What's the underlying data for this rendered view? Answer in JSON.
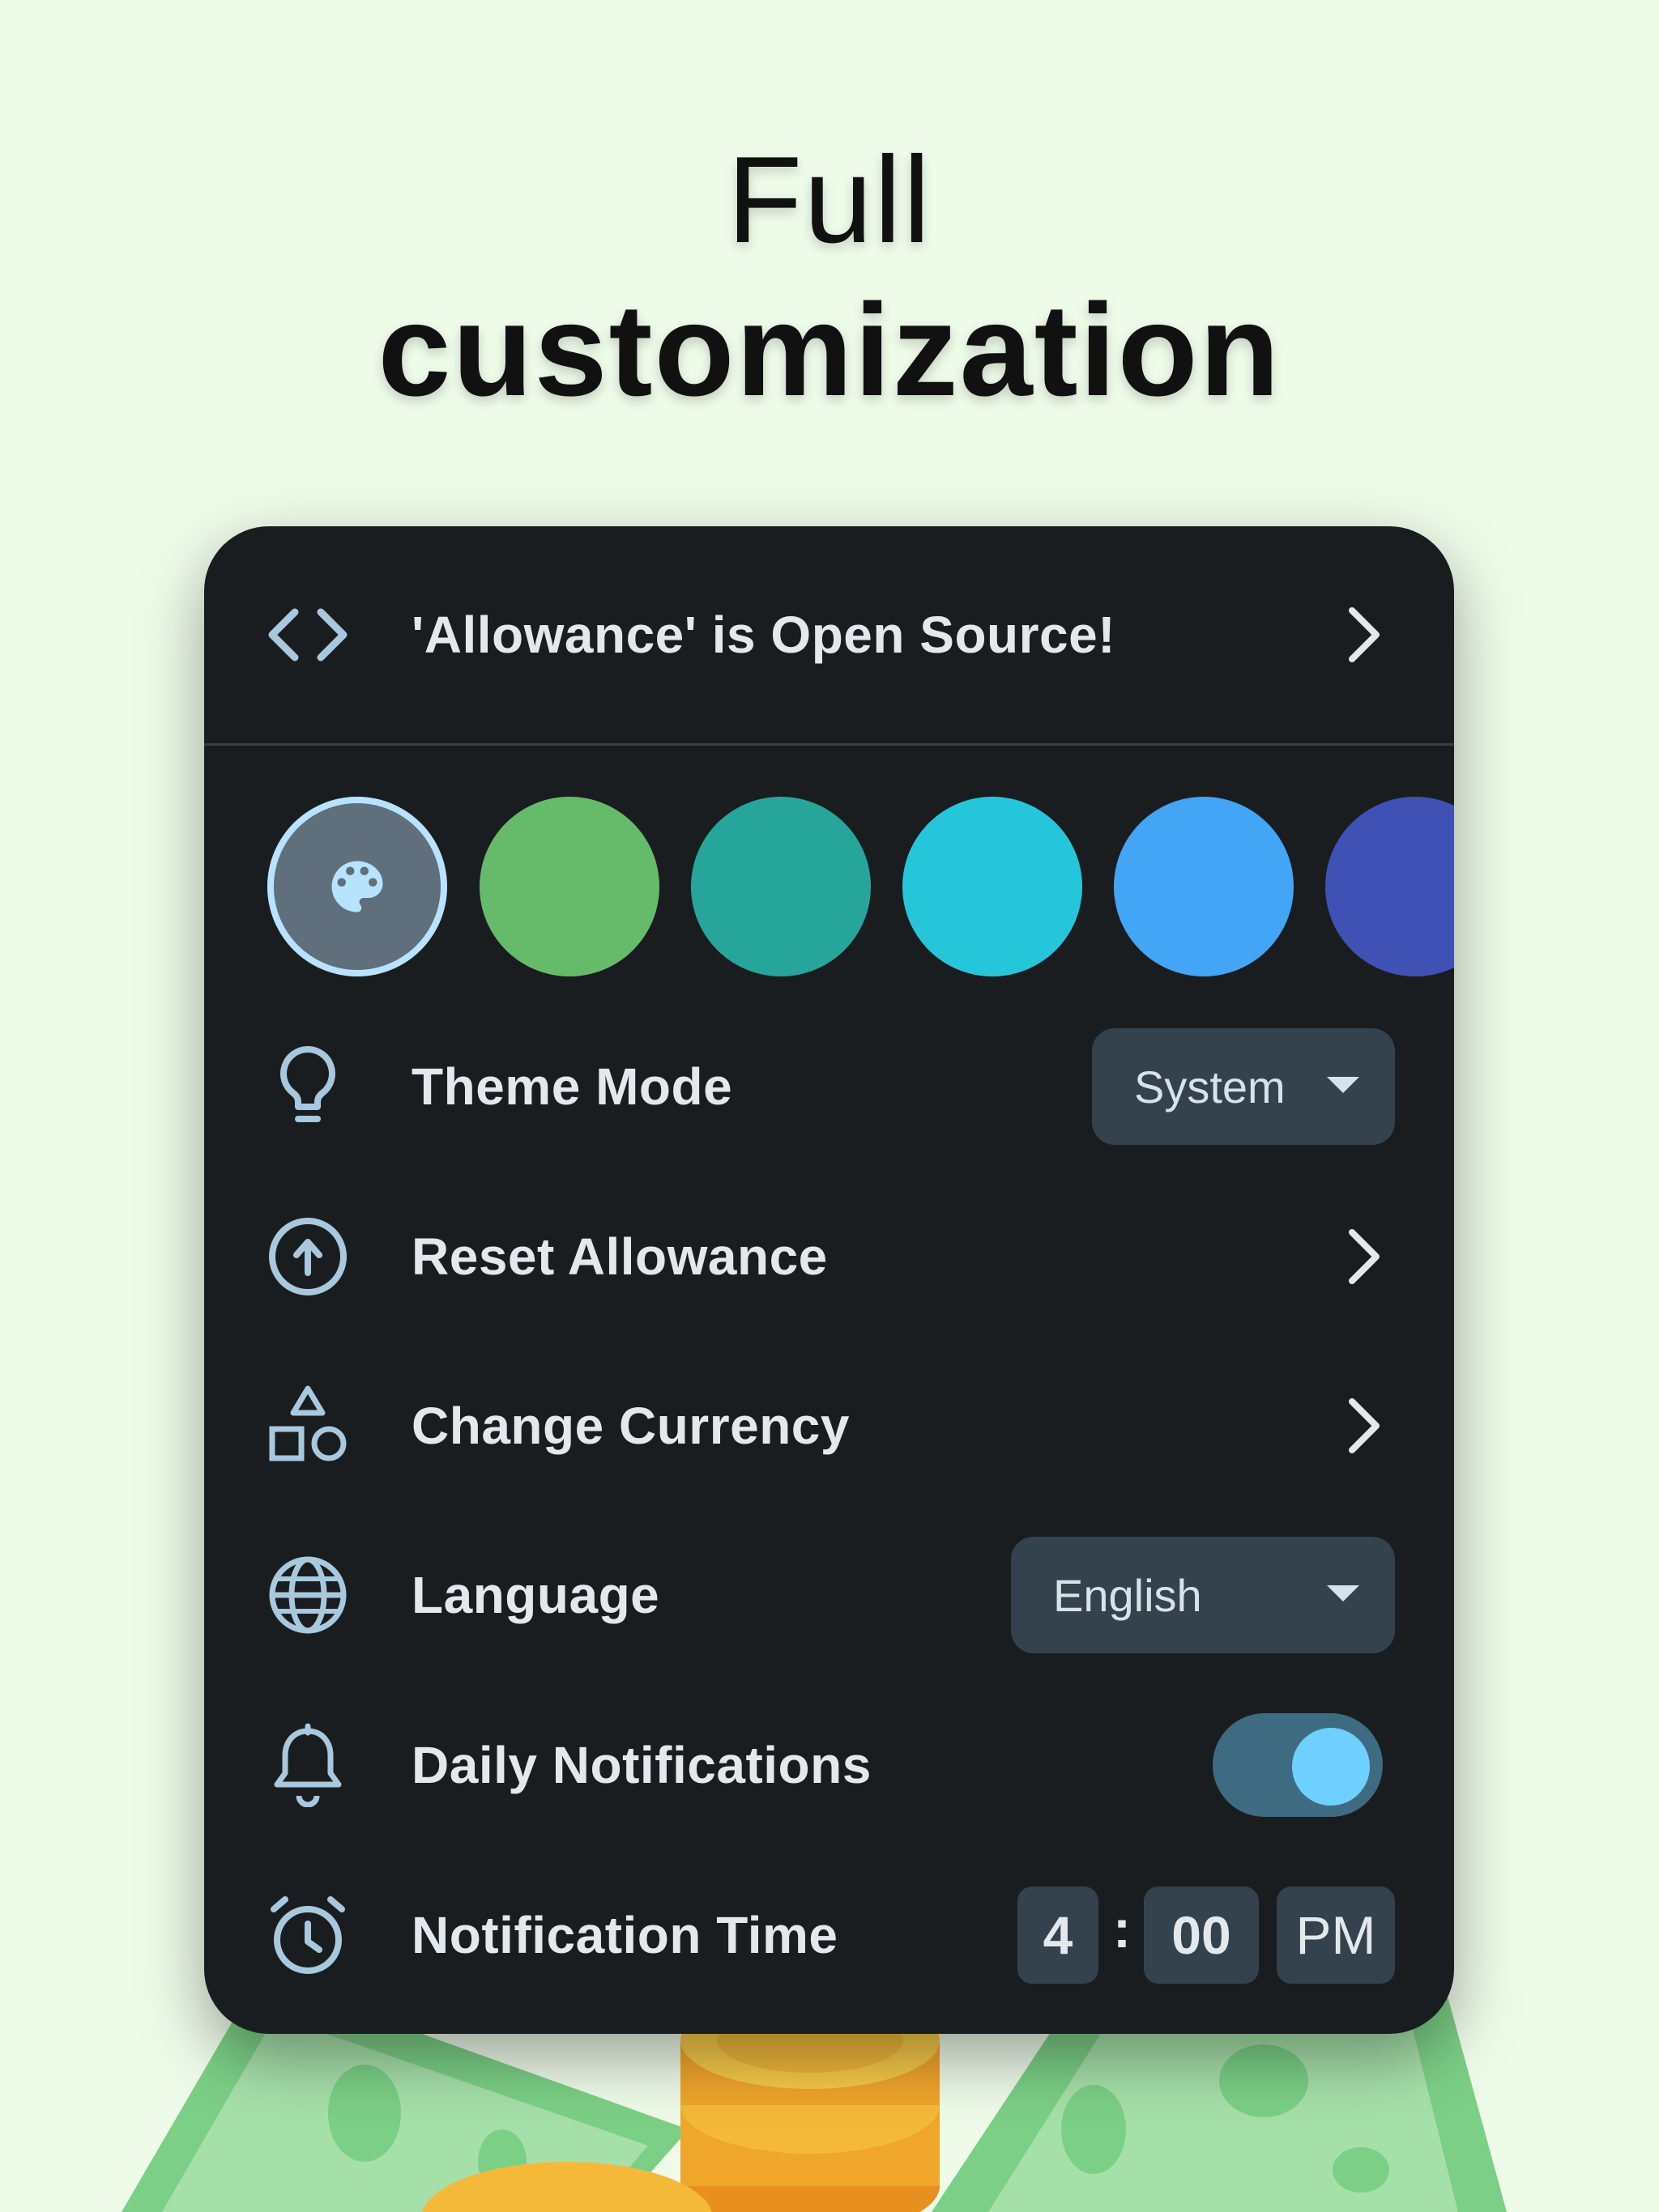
{
  "headline": {
    "line1": "Full",
    "line2": "customization"
  },
  "settings": {
    "open_source": {
      "label": "'Allowance' is Open Source!",
      "icon": "code-icon"
    },
    "color_swatches": {
      "selected_icon": "palette-icon",
      "colors": [
        "#5f6f7b",
        "#66bb6a",
        "#26a69a",
        "#26c6da",
        "#42a5f5",
        "#3f51b5"
      ]
    },
    "theme_mode": {
      "label": "Theme Mode",
      "value": "System",
      "icon": "lightbulb-icon"
    },
    "reset_allowance": {
      "label": "Reset Allowance",
      "icon": "arrow-up-circle-icon"
    },
    "change_currency": {
      "label": "Change Currency",
      "icon": "shapes-icon"
    },
    "language": {
      "label": "Language",
      "value": "English",
      "icon": "globe-icon"
    },
    "daily_notifications": {
      "label": "Daily Notifications",
      "enabled": true,
      "icon": "bell-icon"
    },
    "notification_time": {
      "label": "Notification Time",
      "hour": "4",
      "separator": ":",
      "minute": "00",
      "period": "PM",
      "icon": "alarm-clock-icon"
    }
  },
  "colors": {
    "background": "#eefbe9",
    "card": "#1a1d20",
    "accent": "#6fd0ff",
    "control_bg": "#34424e"
  }
}
